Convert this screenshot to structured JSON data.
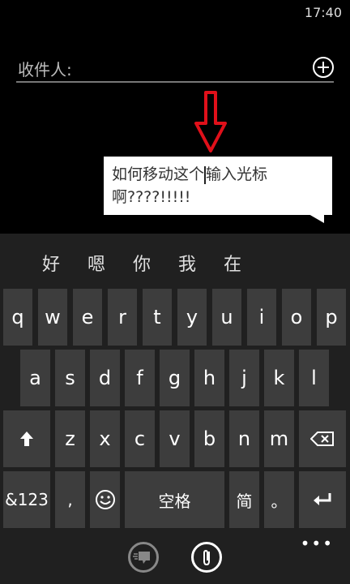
{
  "status": {
    "time": "17:40"
  },
  "compose": {
    "to_label": "收件人:",
    "add_icon": "plus-circle-icon"
  },
  "message": {
    "line1_before_cursor": "如何移动这个",
    "line1_after_cursor": "输入光标",
    "line2": "啊????!!!!!"
  },
  "annotation": {
    "arrow_icon": "red-down-arrow",
    "arrow_color": "#e0101a"
  },
  "keyboard": {
    "suggestions": [
      "好",
      "嗯",
      "你",
      "我",
      "在"
    ],
    "row1": [
      "q",
      "w",
      "e",
      "r",
      "t",
      "y",
      "u",
      "i",
      "o",
      "p"
    ],
    "row2": [
      "a",
      "s",
      "d",
      "f",
      "g",
      "h",
      "j",
      "k",
      "l"
    ],
    "row3": [
      "z",
      "x",
      "c",
      "v",
      "b",
      "n",
      "m"
    ],
    "shift_icon": "shift-arrow-icon",
    "backspace_icon": "backspace-icon",
    "numbers_label": "&123",
    "comma_label": ",",
    "emoji_icon": "smiley-icon",
    "space_label": "空格",
    "mode_label": "简",
    "period_label": "。",
    "enter_icon": "enter-icon"
  },
  "appbar": {
    "send_icon": "send-icon",
    "attach_icon": "paperclip-icon",
    "more_label": "•••"
  }
}
